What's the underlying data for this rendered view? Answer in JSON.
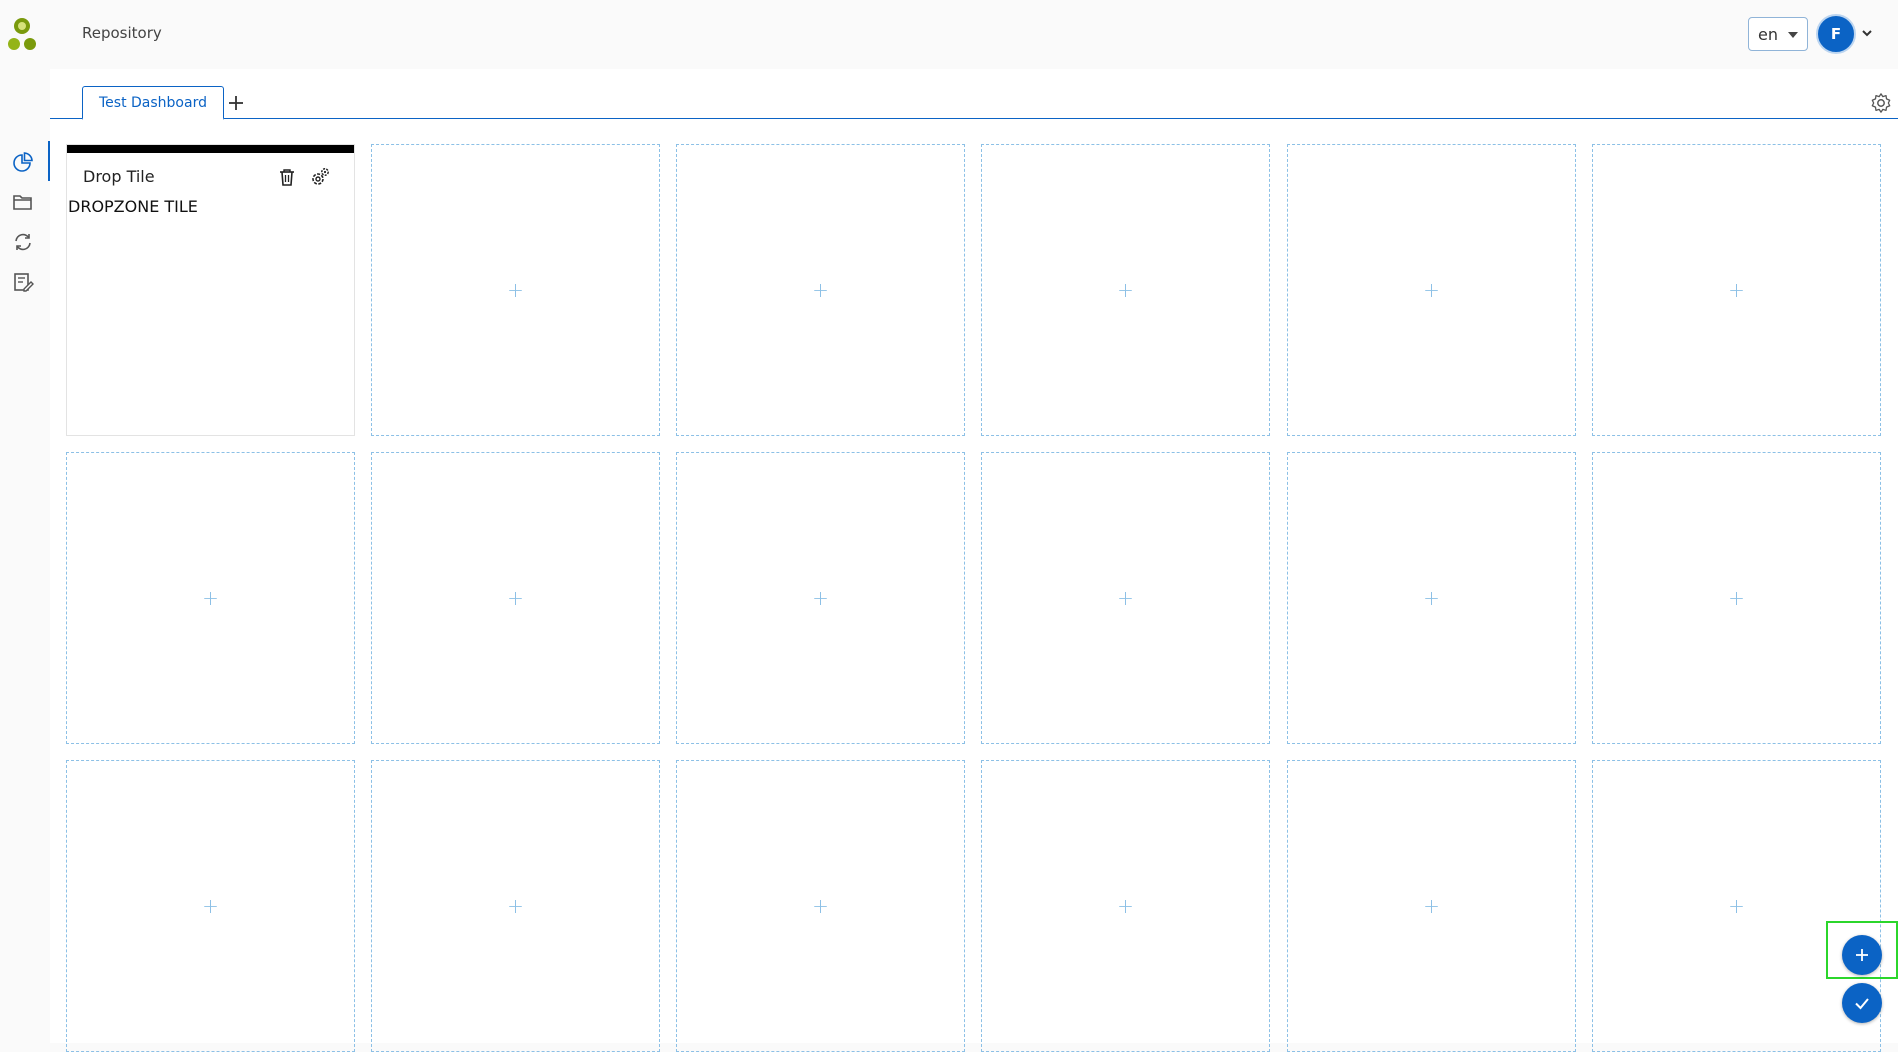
{
  "header": {
    "app_title": "Repository",
    "language": "en",
    "avatar_initial": "F"
  },
  "sidebar": {
    "items": [
      {
        "name": "dashboard-icon",
        "active": true
      },
      {
        "name": "folder-icon",
        "active": false
      },
      {
        "name": "sync-icon",
        "active": false
      },
      {
        "name": "edit-list-icon",
        "active": false
      }
    ]
  },
  "tabs": [
    {
      "label": "Test Dashboard",
      "active": true
    }
  ],
  "tiles": {
    "drop_tile": {
      "title": "Drop Tile",
      "content": "DROPZONE TILE"
    },
    "empty_tile_glyph": "+"
  },
  "fabs": {
    "add": "+",
    "confirm": "✓"
  },
  "colors": {
    "accent": "#0b63c5",
    "tile_border": "#8cc0e6",
    "highlight": "#2bd62b"
  }
}
